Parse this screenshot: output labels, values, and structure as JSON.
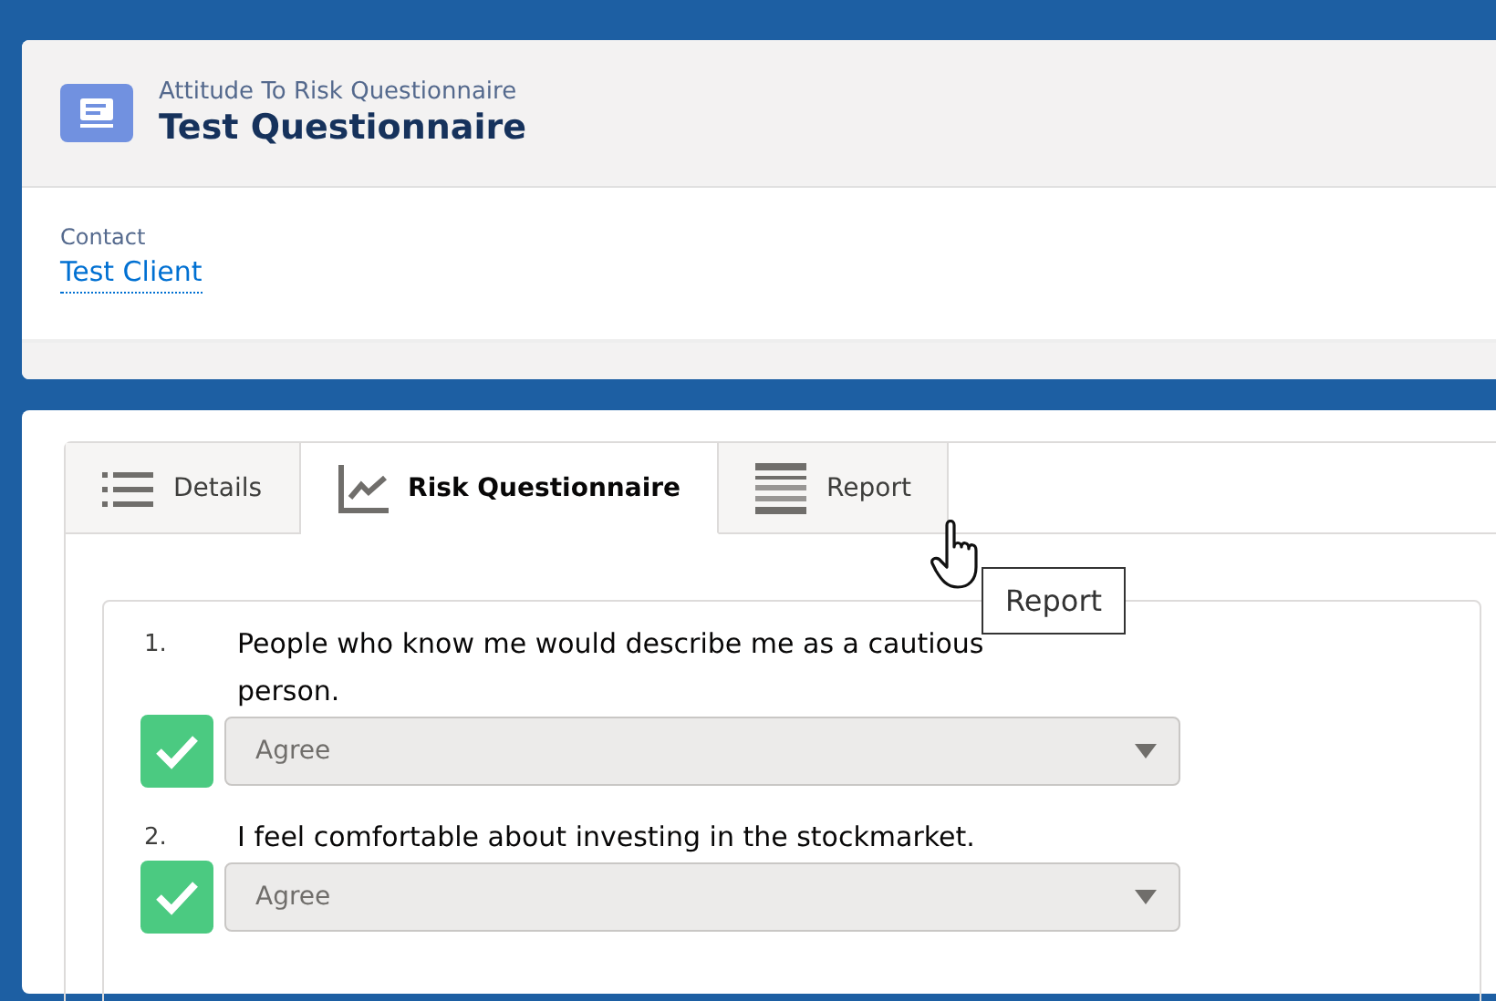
{
  "record": {
    "object_type": "Attitude To Risk Questionnaire",
    "title": "Test Questionnaire"
  },
  "fields": [
    {
      "label": "Contact",
      "value": "Test Client"
    }
  ],
  "tabs": [
    {
      "label": "Details",
      "kind": "list",
      "selected": false
    },
    {
      "label": "Risk Questionnaire",
      "kind": "chart",
      "selected": true
    },
    {
      "label": "Report",
      "kind": "table",
      "selected": false
    }
  ],
  "tooltip": "Report",
  "questions": [
    {
      "number": "1.",
      "text": "People who know me would describe me as a cautious person.",
      "answered": true,
      "answer": "Agree",
      "disabled": true
    },
    {
      "number": "2.",
      "text": "I feel comfortable about investing in the stockmarket.",
      "answered": true,
      "answer": "Agree",
      "disabled": true
    }
  ]
}
